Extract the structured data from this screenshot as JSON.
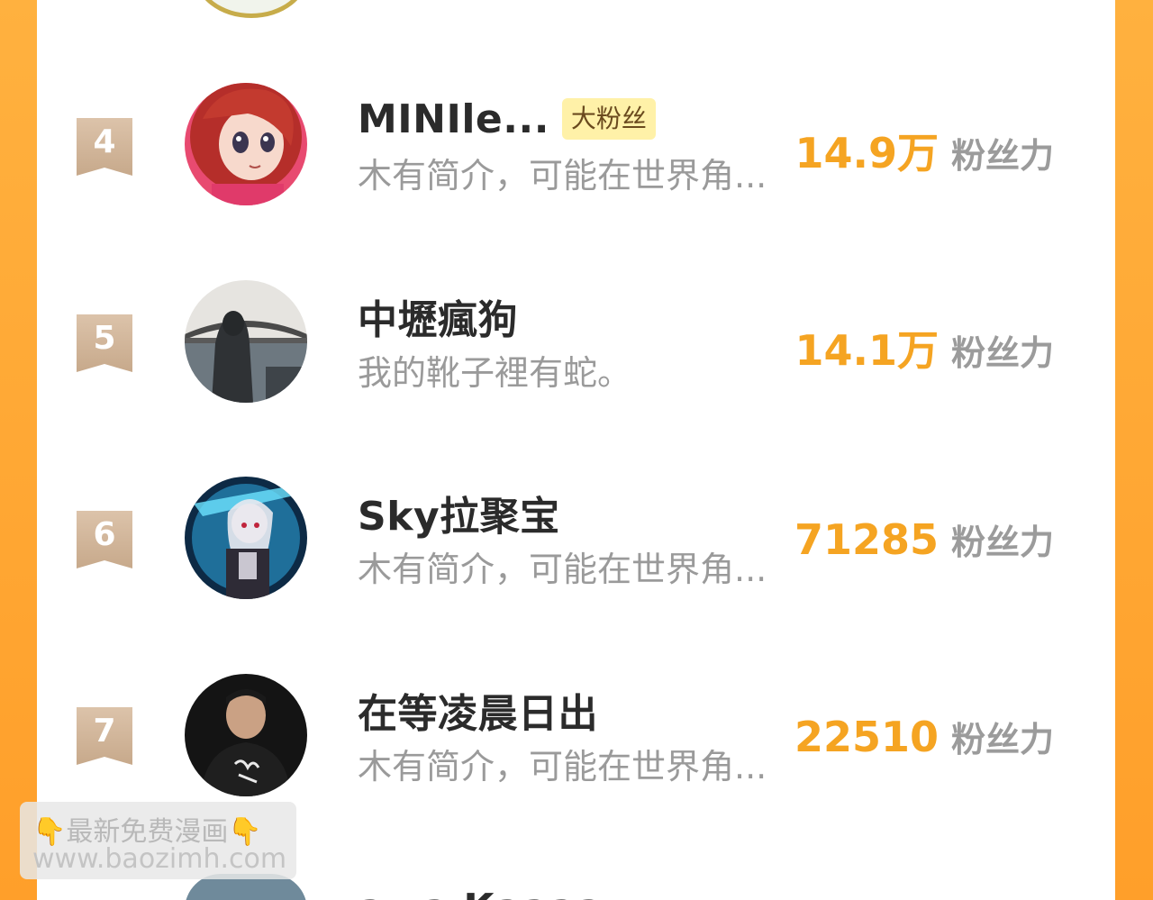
{
  "stat_unit": "粉丝力",
  "rows": [
    {
      "rank": "4",
      "name": "MINIle...",
      "badge": "大粉丝",
      "bio": "木有简介，可能在世界角...",
      "fans": "14.9万",
      "avatar_icon": "anime-girl-red-hair-avatar"
    },
    {
      "rank": "5",
      "name": "中壢瘋狗",
      "bio": "我的靴子裡有蛇。",
      "fans": "14.1万",
      "avatar_icon": "hooded-figure-bridge-avatar"
    },
    {
      "rank": "6",
      "name": "Sky拉聚宝",
      "bio": "木有简介，可能在世界角...",
      "fans": "71285",
      "avatar_icon": "anime-swordsman-avatar"
    },
    {
      "rank": "7",
      "name": "在等凌晨日出",
      "bio": "木有简介，可能在世界角...",
      "fans": "22510",
      "avatar_icon": "man-black-hoodie-avatar"
    }
  ],
  "partial_next": {
    "name_fragment": "awa Kaaaa"
  },
  "watermark": {
    "line1": "最新免费漫画",
    "line2": "www.baozimh.com",
    "hand_glyph": "👇"
  },
  "colors": {
    "frame": "#ffa52e",
    "accent": "#f5a422",
    "badge_bg": "#fff1a8",
    "rank_badge": "#d3b69b"
  }
}
